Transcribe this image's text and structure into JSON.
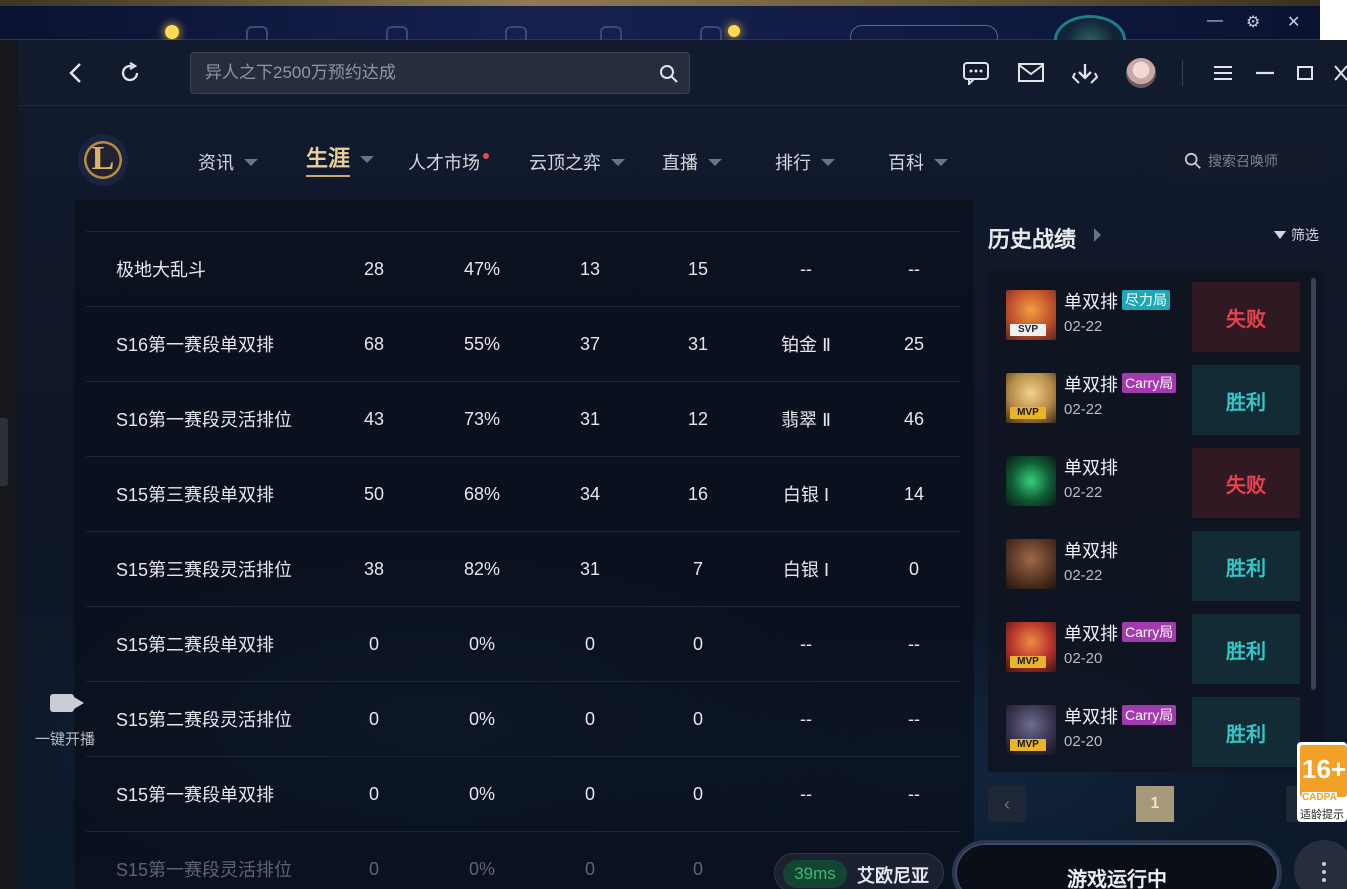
{
  "titlebar": {
    "search_placeholder": "异人之下2500万预约达成"
  },
  "nav": {
    "items": [
      {
        "label": "资讯"
      },
      {
        "label": "生涯"
      },
      {
        "label": "人才市场"
      },
      {
        "label": "云顶之弈"
      },
      {
        "label": "直播"
      },
      {
        "label": "排行"
      },
      {
        "label": "百科"
      }
    ],
    "summoner_search_placeholder": "搜索召唤师"
  },
  "table": {
    "rows": [
      {
        "name": "极地大乱斗",
        "c1": "28",
        "c2": "47%",
        "c3": "13",
        "c4": "15",
        "c5": "--",
        "c6": "--"
      },
      {
        "name": "S16第一赛段单双排",
        "c1": "68",
        "c2": "55%",
        "c3": "37",
        "c4": "31",
        "c5": "铂金 Ⅱ",
        "c6": "25"
      },
      {
        "name": "S16第一赛段灵活排位",
        "c1": "43",
        "c2": "73%",
        "c3": "31",
        "c4": "12",
        "c5": "翡翠 Ⅱ",
        "c6": "46"
      },
      {
        "name": "S15第三赛段单双排",
        "c1": "50",
        "c2": "68%",
        "c3": "34",
        "c4": "16",
        "c5": "白银 Ⅰ",
        "c6": "14"
      },
      {
        "name": "S15第三赛段灵活排位",
        "c1": "38",
        "c2": "82%",
        "c3": "31",
        "c4": "7",
        "c5": "白银 Ⅰ",
        "c6": "0"
      },
      {
        "name": "S15第二赛段单双排",
        "c1": "0",
        "c2": "0%",
        "c3": "0",
        "c4": "0",
        "c5": "--",
        "c6": "--"
      },
      {
        "name": "S15第二赛段灵活排位",
        "c1": "0",
        "c2": "0%",
        "c3": "0",
        "c4": "0",
        "c5": "--",
        "c6": "--"
      },
      {
        "name": "S15第一赛段单双排",
        "c1": "0",
        "c2": "0%",
        "c3": "0",
        "c4": "0",
        "c5": "--",
        "c6": "--"
      },
      {
        "name": "S15第一赛段灵活排位",
        "c1": "0",
        "c2": "0%",
        "c3": "0",
        "c4": "0",
        "c5": "--",
        "c6": "--"
      }
    ]
  },
  "live": {
    "label": "一键开播"
  },
  "history": {
    "title": "历史战绩",
    "filter_label": "筛选",
    "matches": [
      {
        "mode": "单双排",
        "tag": "尽力局",
        "badge": "SVP",
        "date": "02-22",
        "result": "失败"
      },
      {
        "mode": "单双排",
        "tag": "Carry局",
        "badge": "MVP",
        "date": "02-22",
        "result": "胜利"
      },
      {
        "mode": "单双排",
        "tag": "",
        "badge": "",
        "date": "02-22",
        "result": "失败"
      },
      {
        "mode": "单双排",
        "tag": "",
        "badge": "",
        "date": "02-22",
        "result": "胜利"
      },
      {
        "mode": "单双排",
        "tag": "Carry局",
        "badge": "MVP",
        "date": "02-20",
        "result": "胜利"
      },
      {
        "mode": "单双排",
        "tag": "Carry局",
        "badge": "MVP",
        "date": "02-20",
        "result": "胜利"
      }
    ],
    "page": "1"
  },
  "footer": {
    "ping": "39ms",
    "server": "艾欧尼亚",
    "launch_label": "游戏运行中"
  },
  "age_badge": {
    "rating": "16+",
    "code": "CADPA",
    "tip": "适龄提示"
  },
  "colors": {
    "accent_gold": "#e8d19e",
    "win": "#35c7c8",
    "lose": "#e6424f",
    "ping_green": "#3fb574",
    "tag_cyan": "#1fa7b7",
    "tag_purple": "#a43ab0",
    "mvp_gold": "#e8b52a"
  }
}
